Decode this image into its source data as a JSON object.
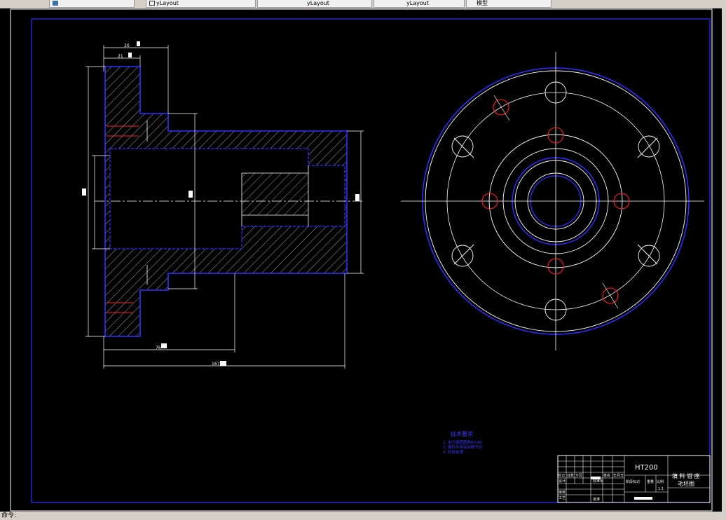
{
  "tabs": [
    {
      "label": "",
      "icon": "sheet-icon"
    },
    {
      "label": "yLayout",
      "icon": "sheet-icon"
    },
    {
      "label": "yLayout",
      "icon": "sheet-icon"
    },
    {
      "label": "yLayout",
      "icon": "sheet-icon"
    },
    {
      "label": "模型",
      "icon": "sheet-icon"
    }
  ],
  "drawing": {
    "material": "HT200",
    "part_name_1": "填 料 钳 座",
    "part_name_2": "毛坯图",
    "tech_req_title": "技术要求",
    "tech_req_lines": [
      "1. 未注铸造圆角R3-R5",
      "2. 铸件不得有砂眼气孔",
      "3. 时效处理"
    ],
    "dims": {
      "d1": "30",
      "d2": "21",
      "d3": "76",
      "d4": "167"
    },
    "title_block": {
      "marks": "标记",
      "count": "处数",
      "zone": "分区",
      "change_doc": "更改文件号",
      "sign": "签名",
      "date": "年月日",
      "design": "设计",
      "std": "标准化",
      "stage_mark": "阶段标记",
      "weight": "重量",
      "scale": "比例",
      "review": "审核",
      "process": "工艺",
      "approve": "批准",
      "scale_value": "1:1"
    }
  },
  "status": {
    "text": "命令:"
  }
}
